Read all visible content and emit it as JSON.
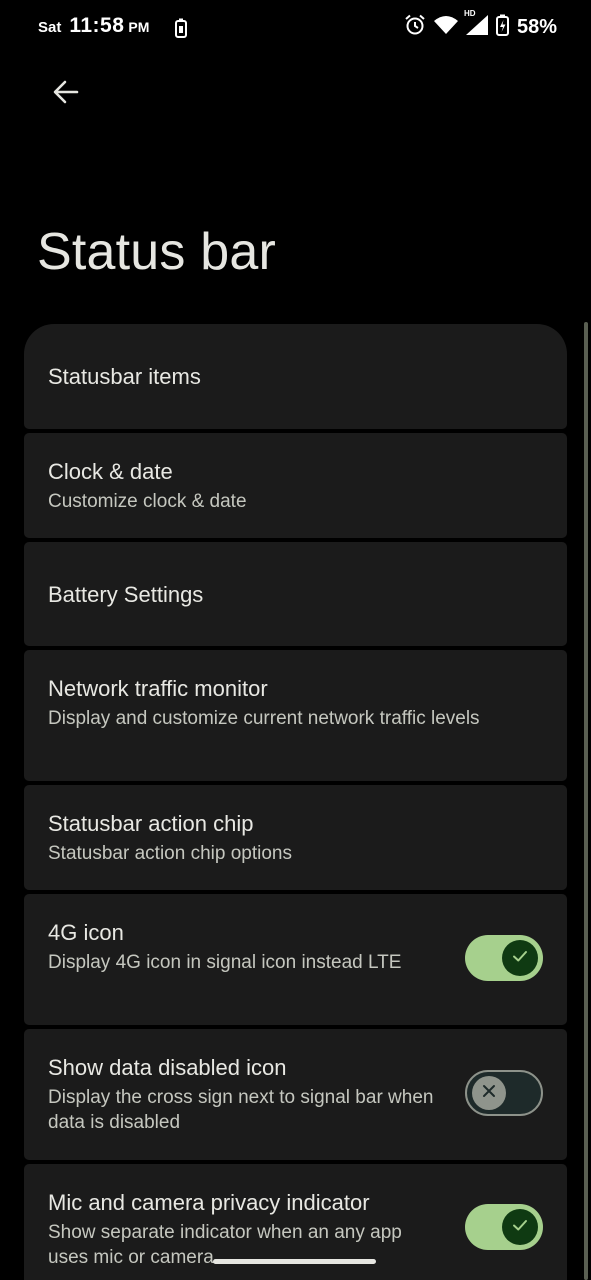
{
  "status_bar": {
    "day": "Sat",
    "time": "11:58",
    "ampm": "PM",
    "battery_percent": "58%",
    "network_badge": "HD",
    "icons": [
      "battery-saver-icon",
      "alarm-icon",
      "wifi-icon",
      "signal-icon",
      "battery-charging-icon"
    ]
  },
  "header": {
    "back_icon": "arrow-back-icon",
    "title": "Status bar"
  },
  "items": [
    {
      "title": "Statusbar items",
      "summary": ""
    },
    {
      "title": "Clock & date",
      "summary": "Customize clock & date"
    },
    {
      "title": "Battery Settings",
      "summary": ""
    },
    {
      "title": "Network traffic monitor",
      "summary": "Display and customize current network traffic levels"
    },
    {
      "title": "Statusbar action chip",
      "summary": "Statusbar action chip options"
    },
    {
      "title": "4G icon",
      "summary": "Display 4G icon in signal icon instead LTE",
      "toggle": true,
      "toggle_icon": "check-icon"
    },
    {
      "title": "Show data disabled icon",
      "summary": "Display the cross sign next to signal bar when data is disabled",
      "toggle": false,
      "toggle_icon": "close-icon"
    },
    {
      "title": "Mic and camera privacy indicator",
      "summary": "Show separate indicator when an any app uses mic or camera",
      "toggle": true,
      "toggle_icon": "check-icon"
    }
  ],
  "colors": {
    "background": "#000000",
    "card": "#1b1b1b",
    "switch_on_track": "#a6d08d",
    "switch_on_thumb": "#0f3a12",
    "switch_off_thumb": "#8f948c"
  }
}
